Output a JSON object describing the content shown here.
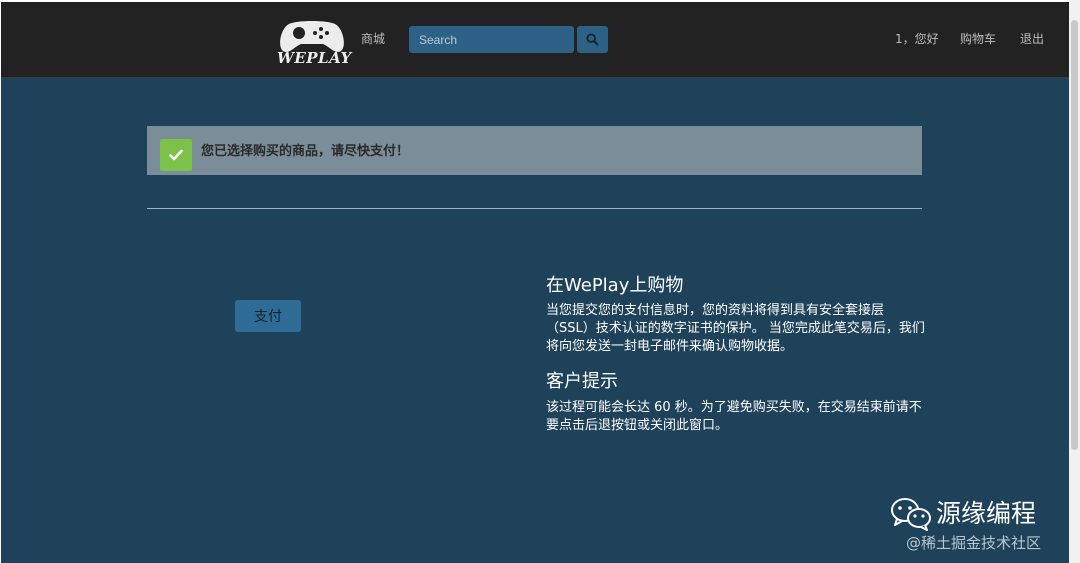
{
  "nav": {
    "logo_text": "WEPLAY",
    "mall_link": "商城",
    "search_placeholder": "Search",
    "user_greeting": "1，您好",
    "cart_link": "购物车",
    "logout_link": "退出"
  },
  "alert": {
    "message": "您已选择购买的商品，请尽快支付！",
    "icon": "check-icon",
    "icon_color": "#7cc24a"
  },
  "payment": {
    "pay_button_label": "支付"
  },
  "info": {
    "section1_title": "在WePlay上购物",
    "section1_body": "当您提交您的支付信息时，您的资料将得到具有安全套接层（SSL）技术认证的数字证书的保护。 当您完成此笔交易后，我们将向您发送一封电子邮件来确认购物收据。",
    "section2_title": "客户提示",
    "section2_body": "该过程可能会长达 60 秒。为了避免购买失败，在交易结束前请不要点击后退按钮或关闭此窗口。"
  },
  "watermark": {
    "brand": "源缘编程",
    "site": "@稀土掘金技术社区"
  },
  "colors": {
    "page_background": "#1e425a",
    "navbar_background": "#222222",
    "accent_blue": "#2e6186",
    "alert_background": "#7c8d9a"
  }
}
